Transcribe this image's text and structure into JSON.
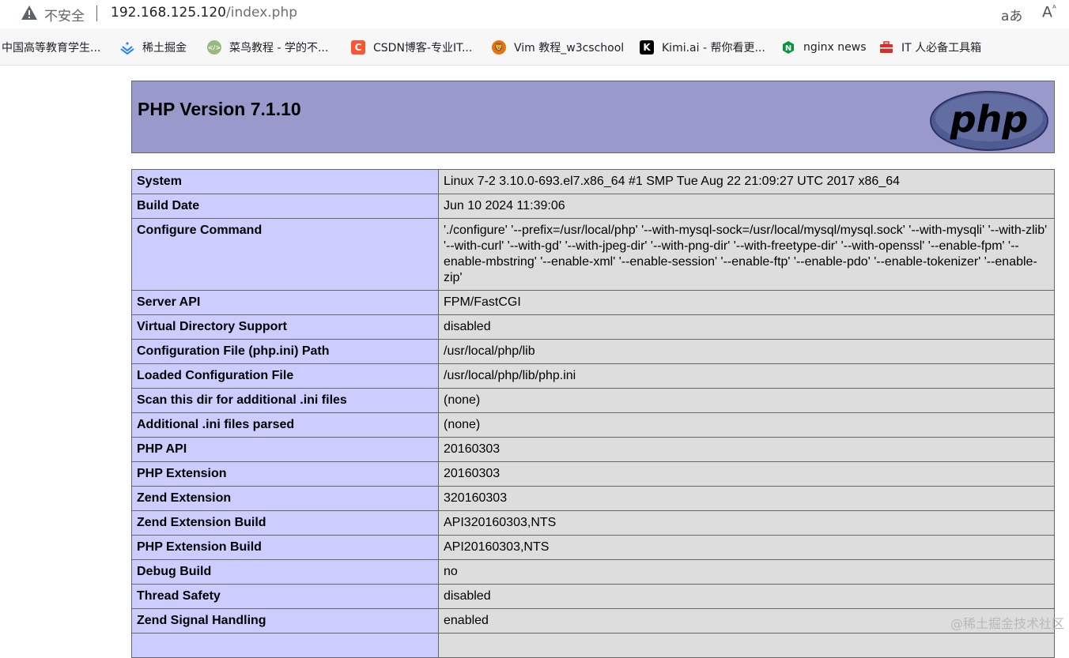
{
  "browser": {
    "security_label": "不安全",
    "url_host": "192.168.125.120",
    "url_path": "/index.php",
    "read_aloud_label": "aあ",
    "font_label": "Aᴬ"
  },
  "bookmarks": [
    {
      "label": "中国高等教育学生...",
      "icon": "none",
      "color": ""
    },
    {
      "label": "稀土掘金",
      "icon": "juejin-icon",
      "color": "#1e80ff"
    },
    {
      "label": "菜鸟教程 - 学的不...",
      "icon": "runoob-icon",
      "color": "#96b97d"
    },
    {
      "label": "CSDN博客-专业IT...",
      "icon": "csdn-icon",
      "color": "#fc5531"
    },
    {
      "label": "Vim 教程_w3cschool",
      "icon": "w3cschool-icon",
      "color": "#e8730a"
    },
    {
      "label": "Kimi.ai - 帮你看更...",
      "icon": "kimi-icon",
      "color": "#000000"
    },
    {
      "label": "nginx news",
      "icon": "nginx-icon",
      "color": "#009639"
    },
    {
      "label": "IT 人必备工具箱",
      "icon": "toolbox-icon",
      "color": "#d32f2f"
    }
  ],
  "php": {
    "title": "PHP Version 7.1.10",
    "logo_text": "php",
    "rows": [
      {
        "key": "System",
        "value": "Linux 7-2 3.10.0-693.el7.x86_64 #1 SMP Tue Aug 22 21:09:27 UTC 2017 x86_64"
      },
      {
        "key": "Build Date",
        "value": "Jun 10 2024 11:39:06"
      },
      {
        "key": "Configure Command",
        "value": "'./configure' '--prefix=/usr/local/php' '--with-mysql-sock=/usr/local/mysql/mysql.sock' '--with-mysqli' '--with-zlib' '--with-curl' '--with-gd' '--with-jpeg-dir' '--with-png-dir' '--with-freetype-dir' '--with-openssl' '--enable-fpm' '--enable-mbstring' '--enable-xml' '--enable-session' '--enable-ftp' '--enable-pdo' '--enable-tokenizer' '--enable-zip'"
      },
      {
        "key": "Server API",
        "value": "FPM/FastCGI"
      },
      {
        "key": "Virtual Directory Support",
        "value": "disabled"
      },
      {
        "key": "Configuration File (php.ini) Path",
        "value": "/usr/local/php/lib"
      },
      {
        "key": "Loaded Configuration File",
        "value": "/usr/local/php/lib/php.ini"
      },
      {
        "key": "Scan this dir for additional .ini files",
        "value": "(none)"
      },
      {
        "key": "Additional .ini files parsed",
        "value": "(none)"
      },
      {
        "key": "PHP API",
        "value": "20160303"
      },
      {
        "key": "PHP Extension",
        "value": "20160303"
      },
      {
        "key": "Zend Extension",
        "value": "320160303"
      },
      {
        "key": "Zend Extension Build",
        "value": "API320160303,NTS"
      },
      {
        "key": "PHP Extension Build",
        "value": "API20160303,NTS"
      },
      {
        "key": "Debug Build",
        "value": "no"
      },
      {
        "key": "Thread Safety",
        "value": "disabled"
      },
      {
        "key": "Zend Signal Handling",
        "value": "enabled"
      },
      {
        "key": "",
        "value": ""
      }
    ]
  },
  "watermark": "@稀土掘金技术社区"
}
